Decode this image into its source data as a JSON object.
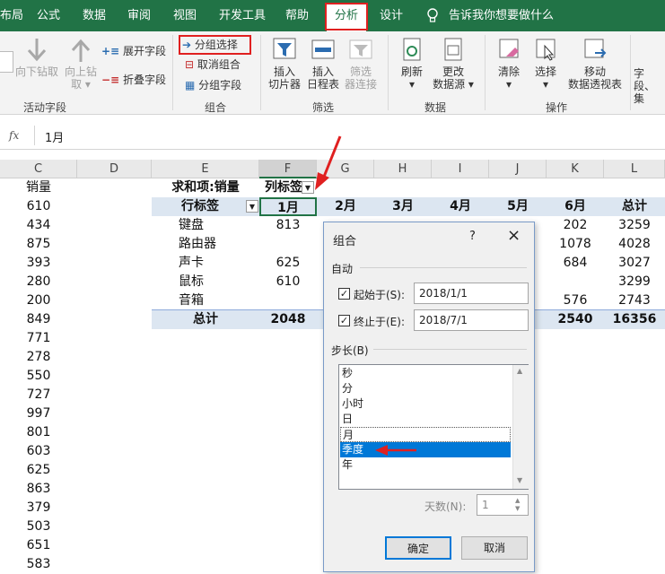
{
  "tabs": [
    "布局",
    "公式",
    "数据",
    "审阅",
    "视图",
    "开发工具",
    "帮助",
    "分析",
    "设计"
  ],
  "tell_me": "告诉我你想要做什么",
  "ribbon": {
    "drill_down": "向下钻取",
    "drill_up": "向上钻",
    "drill_up2": "取",
    "expand_field": "展开字段",
    "collapse_field": "折叠字段",
    "group_active_field": "活动字段",
    "group_selection": "分组选择",
    "ungroup": "取消组合",
    "group_field": "分组字段",
    "group_group": "组合",
    "insert_slicer_1": "插入",
    "insert_slicer_2": "切片器",
    "insert_timeline_1": "插入",
    "insert_timeline_2": "日程表",
    "filter_conn_1": "筛选",
    "filter_conn_2": "器连接",
    "group_filter": "筛选",
    "refresh": "刷新",
    "change_source_1": "更改",
    "change_source_2": "数据源",
    "group_data": "数据",
    "clear": "清除",
    "select": "选择",
    "move_1": "移动",
    "move_2": "数据透视表",
    "group_actions": "操作",
    "fields_1": "字段、",
    "fields_2": "集"
  },
  "formula_bar": {
    "fx": "fx",
    "value": "1月"
  },
  "columns": [
    "C",
    "D",
    "E",
    "F",
    "G",
    "H",
    "I",
    "J",
    "K",
    "L"
  ],
  "col_c": [
    "销量",
    "610",
    "434",
    "875",
    "393",
    "280",
    "200",
    "849",
    "771",
    "278",
    "550",
    "727",
    "997",
    "801",
    "603",
    "625",
    "863",
    "379",
    "503",
    "651",
    "583"
  ],
  "pivot": {
    "title": "求和项:销量",
    "col_label": "列标签",
    "row_label": "行标签",
    "months": [
      "1月",
      "2月",
      "3月",
      "4月",
      "5月",
      "6月",
      "总计"
    ],
    "rows": [
      {
        "name": "键盘",
        "f": "813",
        "k": "202",
        "l": "3259"
      },
      {
        "name": "路由器",
        "f": "",
        "k": "1078",
        "l": "4028"
      },
      {
        "name": "声卡",
        "f": "625",
        "k": "684",
        "l": "3027"
      },
      {
        "name": "鼠标",
        "f": "610",
        "k": "",
        "l": "3299"
      },
      {
        "name": "音箱",
        "f": "",
        "k": "576",
        "l": "2743"
      }
    ],
    "total_label": "总计",
    "total_f": "2048",
    "total_k": "2540",
    "total_l": "16356"
  },
  "dialog": {
    "title": "组合",
    "help": "?",
    "close": "×",
    "auto": "自动",
    "start_label": "起始于(S):",
    "start_value": "2018/1/1",
    "end_label": "终止于(E):",
    "end_value": "2018/7/1",
    "step_label": "步长(B)",
    "steps": [
      "秒",
      "分",
      "小时",
      "日",
      "月",
      "季度",
      "年"
    ],
    "days_label": "天数(N):",
    "days_value": "1",
    "ok": "确定",
    "cancel": "取消"
  },
  "colors": {
    "excel_green": "#217346",
    "highlight": "#dce6f1",
    "select_blue": "#0078d7",
    "annotation_red": "#e02020"
  }
}
